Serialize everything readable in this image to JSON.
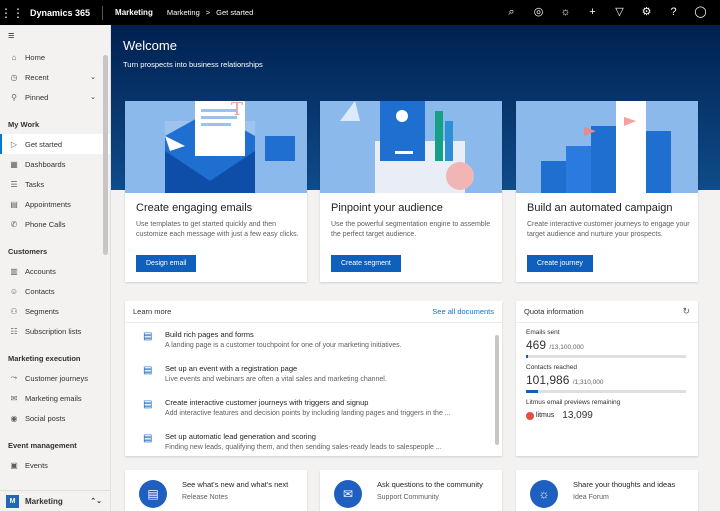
{
  "topbar": {
    "brand": "Dynamics 365",
    "app": "Marketing",
    "breadcrumb": [
      "Marketing",
      ">",
      "Get started"
    ]
  },
  "sidebar": {
    "items_top": [
      {
        "label": "Home",
        "icon": "home-icon"
      },
      {
        "label": "Recent",
        "icon": "clock-icon"
      },
      {
        "label": "Pinned",
        "icon": "pin-icon"
      }
    ],
    "groups": [
      {
        "title": "My Work",
        "items": [
          "Get started",
          "Dashboards",
          "Tasks",
          "Appointments",
          "Phone Calls"
        ]
      },
      {
        "title": "Customers",
        "items": [
          "Accounts",
          "Contacts",
          "Segments",
          "Subscription lists"
        ]
      },
      {
        "title": "Marketing execution",
        "items": [
          "Customer journeys",
          "Marketing emails",
          "Social posts"
        ]
      },
      {
        "title": "Event management",
        "items": [
          "Events"
        ]
      }
    ],
    "area": {
      "letter": "M",
      "label": "Marketing"
    }
  },
  "hero": {
    "title": "Welcome",
    "subtitle": "Turn prospects into business relationships"
  },
  "cards": [
    {
      "title": "Create engaging emails",
      "desc": "Use templates to get started quickly and then customize each message with just a few easy clicks.",
      "button": "Design email"
    },
    {
      "title": "Pinpoint your audience",
      "desc": "Use the powerful segmentation engine to assemble the perfect target audience.",
      "button": "Create segment"
    },
    {
      "title": "Build an automated campaign",
      "desc": "Create interactive customer journeys to engage your target audience and nurture your prospects.",
      "button": "Create journey"
    }
  ],
  "learn": {
    "title": "Learn more",
    "see_all": "See all documents",
    "items": [
      {
        "title": "Build rich pages and forms",
        "desc": "A landing page is a customer touchpoint for one of your marketing initiatives."
      },
      {
        "title": "Set up an event with a registration page",
        "desc": "Live events and webinars are often a vital sales and marketing channel."
      },
      {
        "title": "Create interactive customer journeys with triggers and signup",
        "desc": "Add interactive features and decision points by including landing pages and triggers in the ..."
      },
      {
        "title": "Set up automatic lead generation and scoring",
        "desc": "Finding new leads, qualifying them, and then sending sales-ready leads to salespeople ..."
      }
    ]
  },
  "quota": {
    "title": "Quota information",
    "emails_label": "Emails sent",
    "emails_value": "469",
    "emails_total": "/13,100,000",
    "emails_fraction": 4e-05,
    "contacts_label": "Contacts reached",
    "contacts_value": "101,986",
    "contacts_total": "/1,310,000",
    "contacts_fraction": 0.078,
    "litmus_label": "Litmus email previews remaining",
    "litmus_logo": "litmus",
    "litmus_value": "13,099"
  },
  "bottom": [
    {
      "title": "See what's new and what's next",
      "sub": "Release Notes",
      "icon": "document-icon"
    },
    {
      "title": "Ask questions to the community",
      "sub": "Support Community",
      "icon": "chat-icon"
    },
    {
      "title": "Share your thoughts and ideas",
      "sub": "Idea Forum",
      "icon": "lightbulb-icon"
    }
  ]
}
